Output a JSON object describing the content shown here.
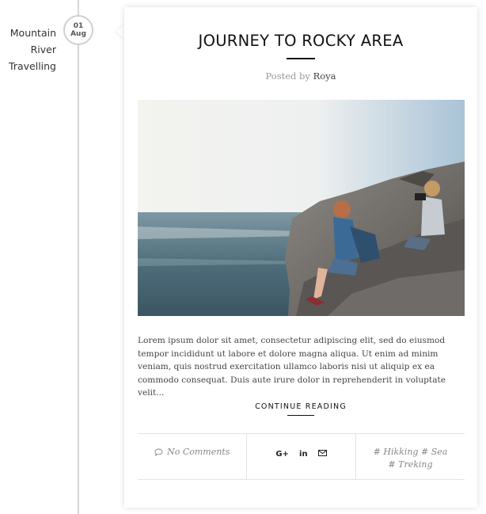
{
  "categories": [
    "Mountain",
    "River",
    "Travelling"
  ],
  "date": {
    "day": "01",
    "month": "Aug"
  },
  "post": {
    "title": "JOURNEY TO ROCKY AREA",
    "posted_by_label": "Posted by",
    "author": "Roya",
    "excerpt": "Lorem ipsum dolor sit amet, consectetur adipiscing elit, sed do eiusmod tempor incididunt ut labore et dolore magna aliqua. Ut enim ad minim veniam, quis nostrud exercitation ullamco laboris nisi ut aliquip ex ea commodo consequat. Duis aute irure dolor in reprehenderit in voluptate velit...",
    "continue_label": "CONTINUE READING"
  },
  "footer": {
    "comments_label": "No Comments",
    "share_icons": [
      "google-plus-icon",
      "linkedin-icon",
      "email-icon"
    ],
    "share_glyphs": {
      "google_plus": "G+",
      "linkedin": "in"
    },
    "tags": [
      "# Hikking",
      "# Sea",
      "# Treking"
    ]
  },
  "colors": {
    "accent": "#111111",
    "muted": "#999999",
    "timeline": "#d6d6d6"
  }
}
